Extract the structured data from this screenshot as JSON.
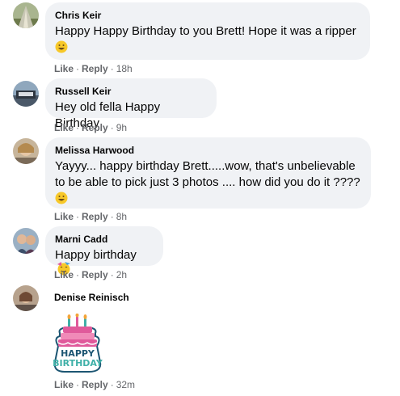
{
  "comments": [
    {
      "author": "Chris Keir",
      "text": "Happy Happy Birthday to you Brett! Hope it was a ripper",
      "emoji": "grinning-face",
      "like": "Like",
      "reply": "Reply",
      "time": "18h"
    },
    {
      "author": "Russell Keir",
      "text": "Hey old fella Happy Birthday",
      "like": "Like",
      "reply": "Reply",
      "time": "9h"
    },
    {
      "author": "Melissa Harwood",
      "text_line1": "Yayyy... happy birthday Brett.....wow, that's unbelievable",
      "text_line2": "to be able to pick just 3 photos .... how did you do it ????",
      "emoji": "grinning-face",
      "like": "Like",
      "reply": "Reply",
      "time": "8h"
    },
    {
      "author": "Marni Cadd",
      "text": "Happy birthday",
      "emoji": "partying-face",
      "like": "Like",
      "reply": "Reply",
      "time": "2h"
    },
    {
      "author": "Denise Reinisch",
      "sticker_line1": "HAPPY",
      "sticker_line2": "BIRTHDAY",
      "sticker": "birthday-cake-sticker",
      "like": "Like",
      "reply": "Reply",
      "time": "32m"
    }
  ],
  "separator": "·",
  "colors": {
    "bubble": "#f0f2f5",
    "meta": "#65676b",
    "text": "#050505"
  }
}
